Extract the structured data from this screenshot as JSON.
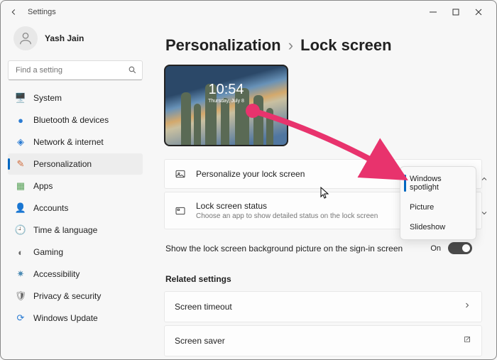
{
  "titlebar": {
    "app": "Settings"
  },
  "user": {
    "name": "Yash Jain"
  },
  "search": {
    "placeholder": "Find a setting"
  },
  "nav": [
    {
      "label": "System",
      "icon": "🖥️",
      "color": "#2b7cd3"
    },
    {
      "label": "Bluetooth & devices",
      "icon": "●",
      "color": "#2b7cd3"
    },
    {
      "label": "Network & internet",
      "icon": "◈",
      "color": "#2b7cd3"
    },
    {
      "label": "Personalization",
      "icon": "✎",
      "color": "#d06a3a",
      "active": true
    },
    {
      "label": "Apps",
      "icon": "▦",
      "color": "#5aa35a"
    },
    {
      "label": "Accounts",
      "icon": "👤",
      "color": "#c98a4a"
    },
    {
      "label": "Time & language",
      "icon": "🕘",
      "color": "#6a6a6a"
    },
    {
      "label": "Gaming",
      "icon": "◐",
      "color": "#6a6a6a"
    },
    {
      "label": "Accessibility",
      "icon": "✷",
      "color": "#4a8ab3"
    },
    {
      "label": "Privacy & security",
      "icon": "🛡",
      "color": "#6a6a6a"
    },
    {
      "label": "Windows Update",
      "icon": "⟳",
      "color": "#2b7cd3"
    }
  ],
  "breadcrumb": {
    "parent": "Personalization",
    "page": "Lock screen"
  },
  "preview": {
    "time": "10:54",
    "date": "Thursday, July 8"
  },
  "rows": {
    "personalize": {
      "title": "Personalize your lock screen"
    },
    "status": {
      "title": "Lock screen status",
      "sub": "Choose an app to show detailed status on the lock screen"
    },
    "signin": {
      "title": "Show the lock screen background picture on the sign-in screen",
      "toggle": "On"
    }
  },
  "related": {
    "heading": "Related settings",
    "timeout": "Screen timeout",
    "saver": "Screen saver"
  },
  "dropdown": {
    "opt1": "Windows spotlight",
    "opt2": "Picture",
    "opt3": "Slideshow"
  }
}
